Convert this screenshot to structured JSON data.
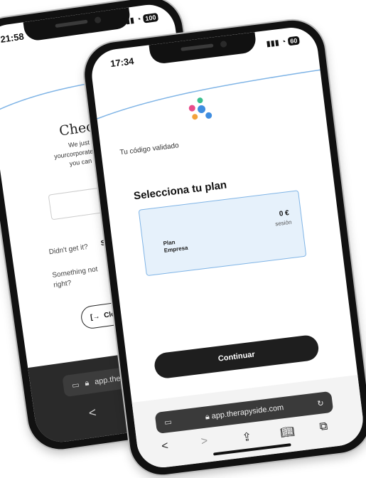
{
  "back_phone": {
    "status_time": "21:58",
    "battery": "100",
    "title": "Check y",
    "subtitle_lines": [
      "We just sent",
      "yourcorporater",
      "you can verif"
    ],
    "didnt_get_it": "Didn't get it?",
    "send_again": "Send a",
    "something_not_right": "Something not\nright?",
    "close_session_label": "Close session",
    "url": "app.ther",
    "nav": {
      "back": "<",
      "forward": ">"
    }
  },
  "front_phone": {
    "status_time": "17:34",
    "battery": "60",
    "code_validated": "Tu código validado",
    "select_plan_heading": "Selecciona tu plan",
    "plan": {
      "name_line1": "Plan",
      "name_line2": "Empresa",
      "price": "0 €",
      "unit": "sesión"
    },
    "continue_label": "Continuar",
    "url": "app.therapyside.com",
    "toolbar": {
      "back": "<",
      "forward": ">"
    }
  },
  "colors": {
    "accent_blue": "#7fb4e6",
    "card_bg": "#e6f1fb",
    "button_dark": "#1e1e1e",
    "logo_pink": "#e94b8a",
    "logo_blue": "#3f8de0",
    "logo_orange": "#f3a23b",
    "logo_green": "#3bbf8e"
  }
}
